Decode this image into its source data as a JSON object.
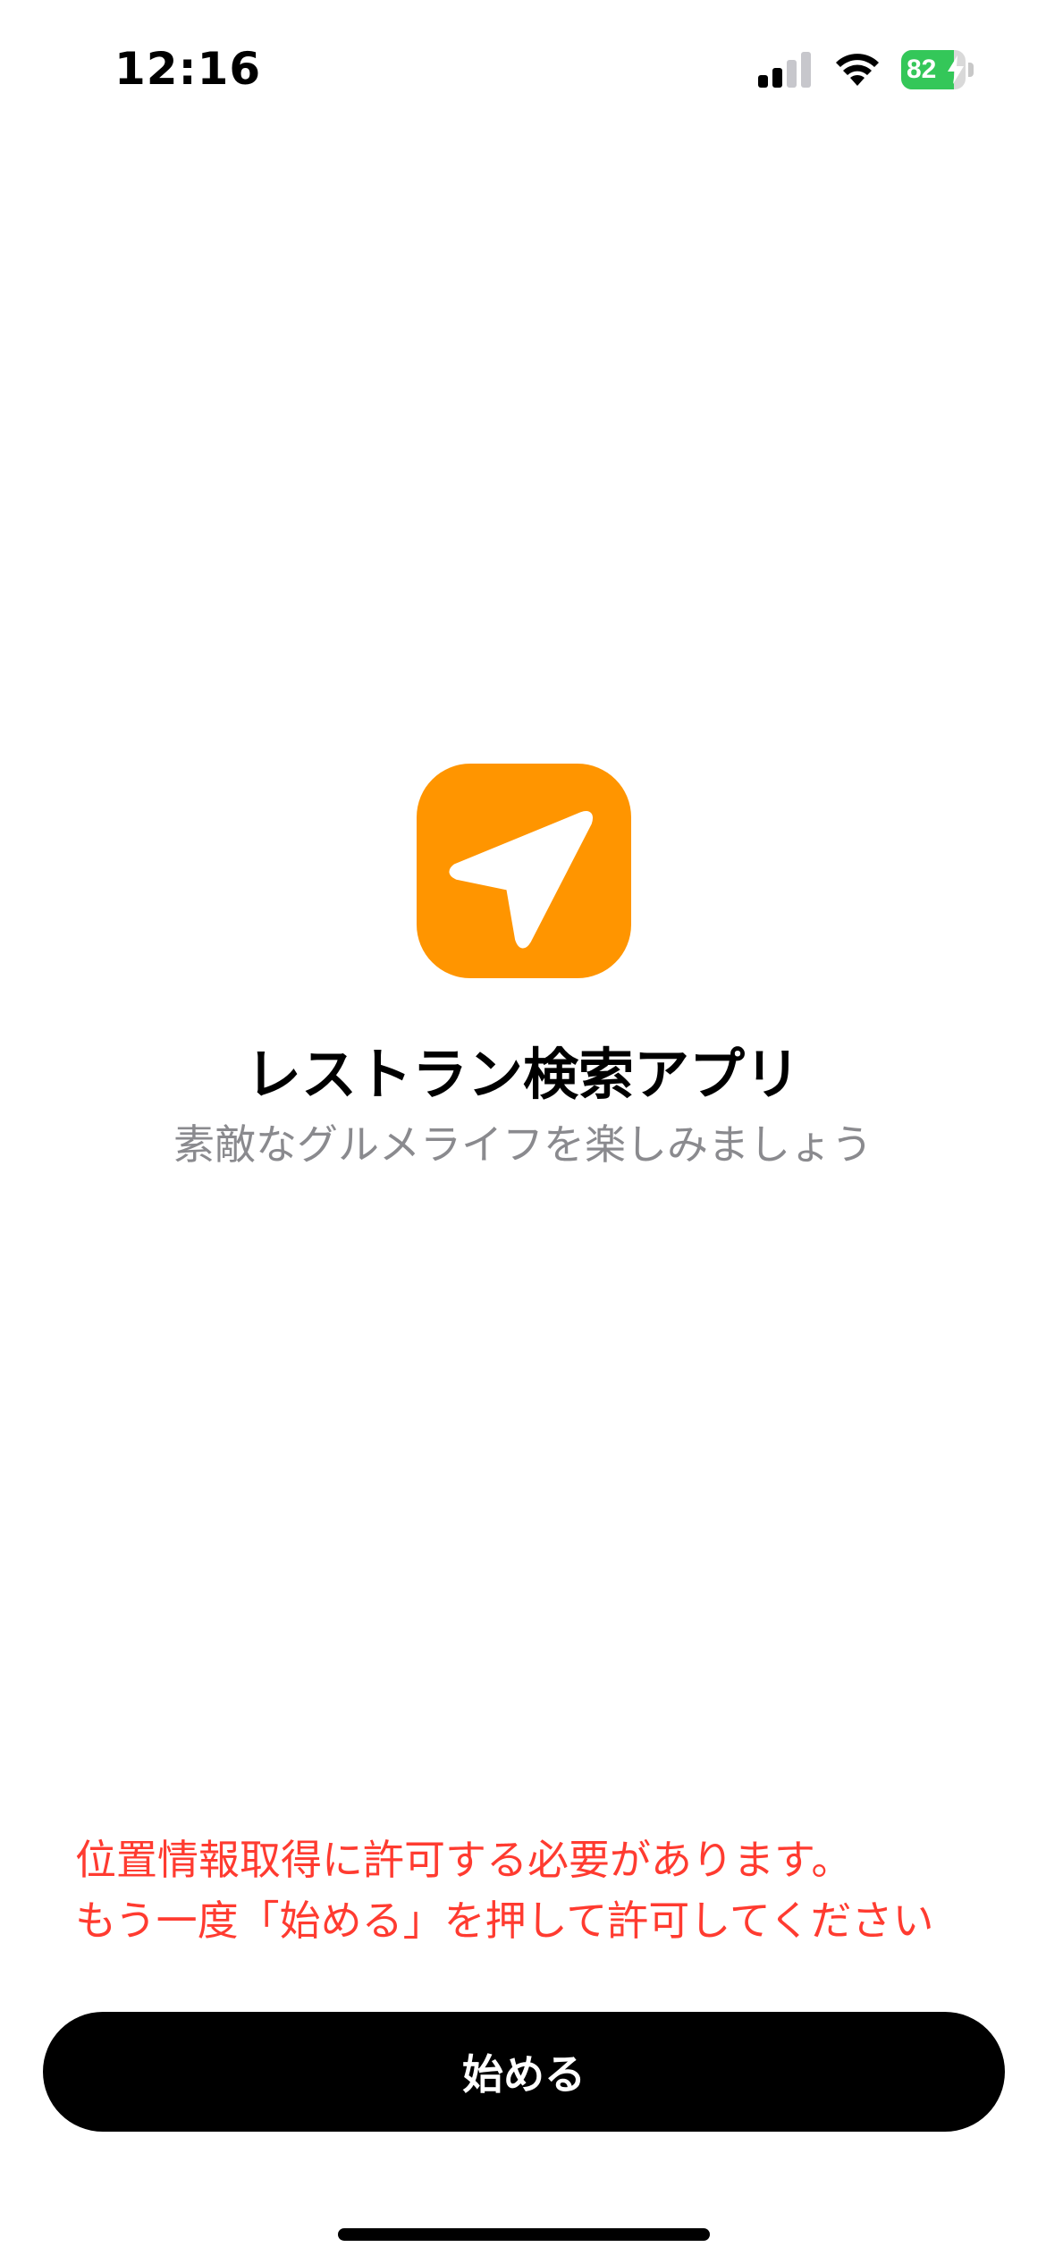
{
  "status_bar": {
    "time": "12:16",
    "battery": {
      "level": "82",
      "level_fraction": 0.82,
      "charging": true,
      "fill_color": "#34c759"
    },
    "signal_bars_active": 2,
    "signal_bars_total": 4,
    "icons": [
      "signal-icon",
      "wifi-icon",
      "battery-icon",
      "charging-bolt-icon"
    ]
  },
  "app": {
    "icon": "location-arrow-icon",
    "icon_color": "#ff9500",
    "title": "レストラン検索アプリ",
    "subtitle": "素敵なグルメライフを楽しみましょう"
  },
  "warning": {
    "line1": "位置情報取得に許可する必要があります。",
    "line2": "もう一度「始める」を押して許可してください",
    "color": "#ff3b30"
  },
  "start_button": {
    "label": "始める"
  }
}
